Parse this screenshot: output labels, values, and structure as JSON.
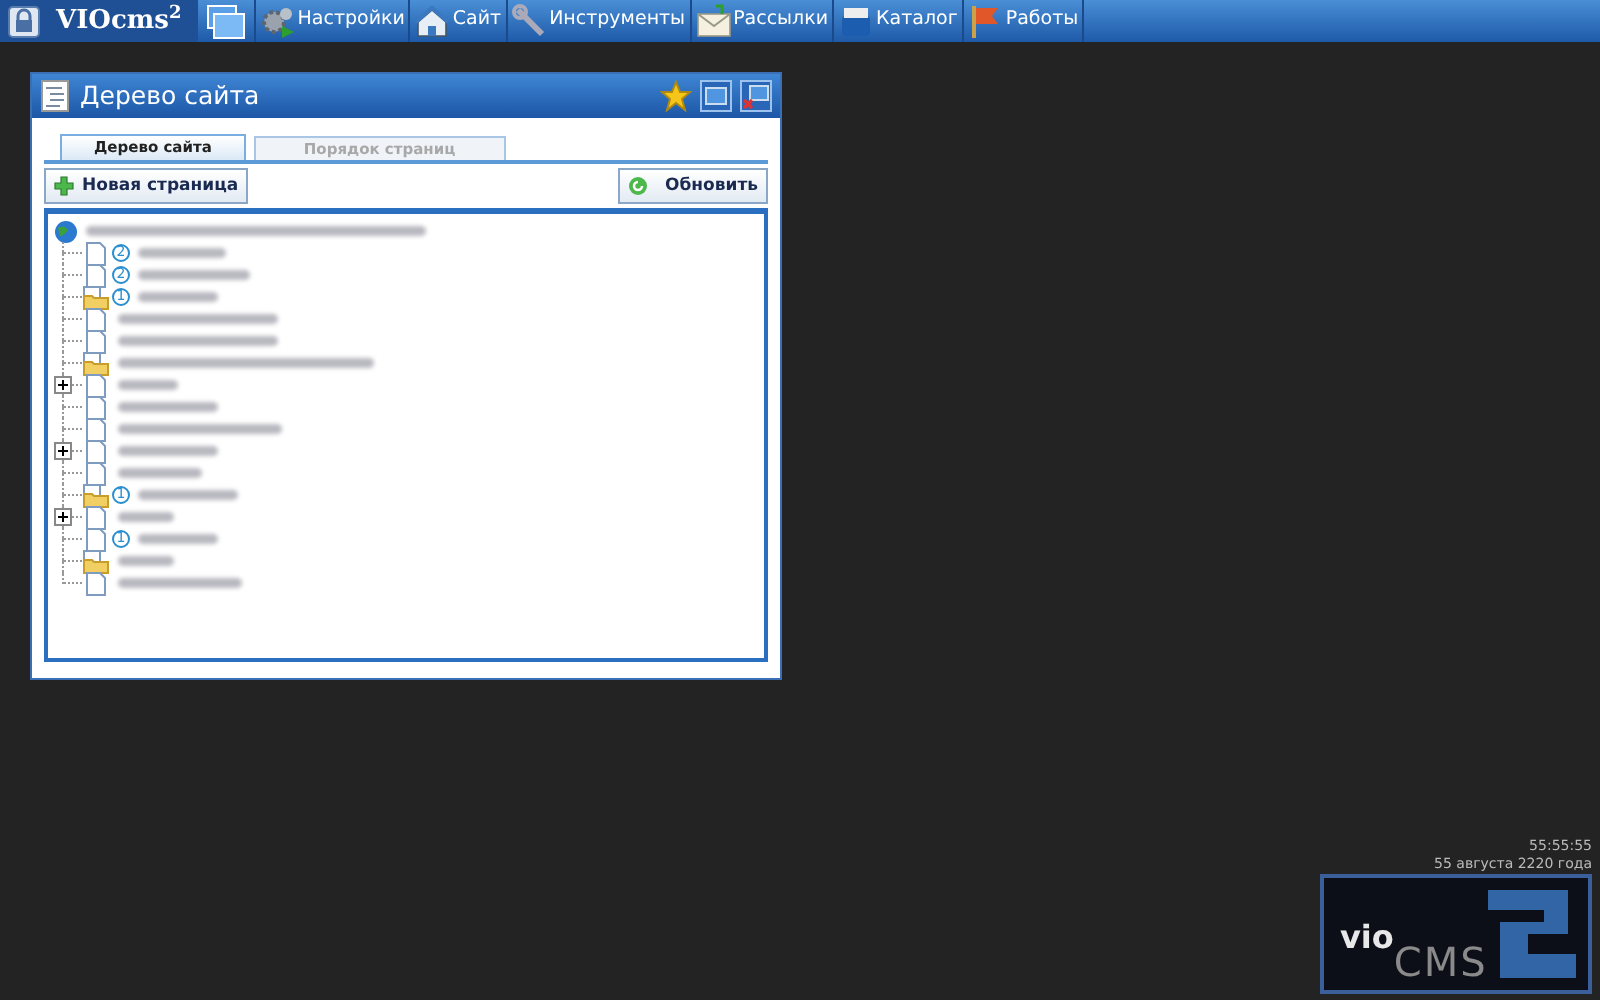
{
  "taskbar": {
    "brand": "VIOcms",
    "brand_sup": "2",
    "items": [
      {
        "label": "Настройки"
      },
      {
        "label": "Сайт"
      },
      {
        "label": "Инструменты"
      },
      {
        "label": "Рассылки"
      },
      {
        "label": "Каталог"
      },
      {
        "label": "Работы"
      }
    ]
  },
  "window": {
    "title": "Дерево сайта"
  },
  "tabs": [
    {
      "label": "Дерево сайта",
      "selected": true
    },
    {
      "label": "Порядок страниц",
      "selected": false
    }
  ],
  "toolbar": {
    "new_page": "Новая страница",
    "refresh": "Обновить"
  },
  "tree": {
    "root": {
      "kind": "globe",
      "children": [
        {
          "kind": "page",
          "badge": "2"
        },
        {
          "kind": "page",
          "badge": "2"
        },
        {
          "kind": "folder",
          "badge": "1"
        },
        {
          "kind": "page"
        },
        {
          "kind": "page"
        },
        {
          "kind": "folder"
        },
        {
          "kind": "page",
          "expanded": false
        },
        {
          "kind": "page"
        },
        {
          "kind": "page"
        },
        {
          "kind": "page",
          "expanded": false
        },
        {
          "kind": "page"
        },
        {
          "kind": "folder",
          "badge": "1"
        },
        {
          "kind": "page",
          "expanded": false
        },
        {
          "kind": "page",
          "badge": "1"
        },
        {
          "kind": "folder"
        },
        {
          "kind": "page"
        }
      ]
    }
  },
  "clock": {
    "time": "55:55:55",
    "date": "55 августа 2220 года"
  },
  "logo": {
    "part_1": "vio",
    "part_2": "CMS"
  }
}
